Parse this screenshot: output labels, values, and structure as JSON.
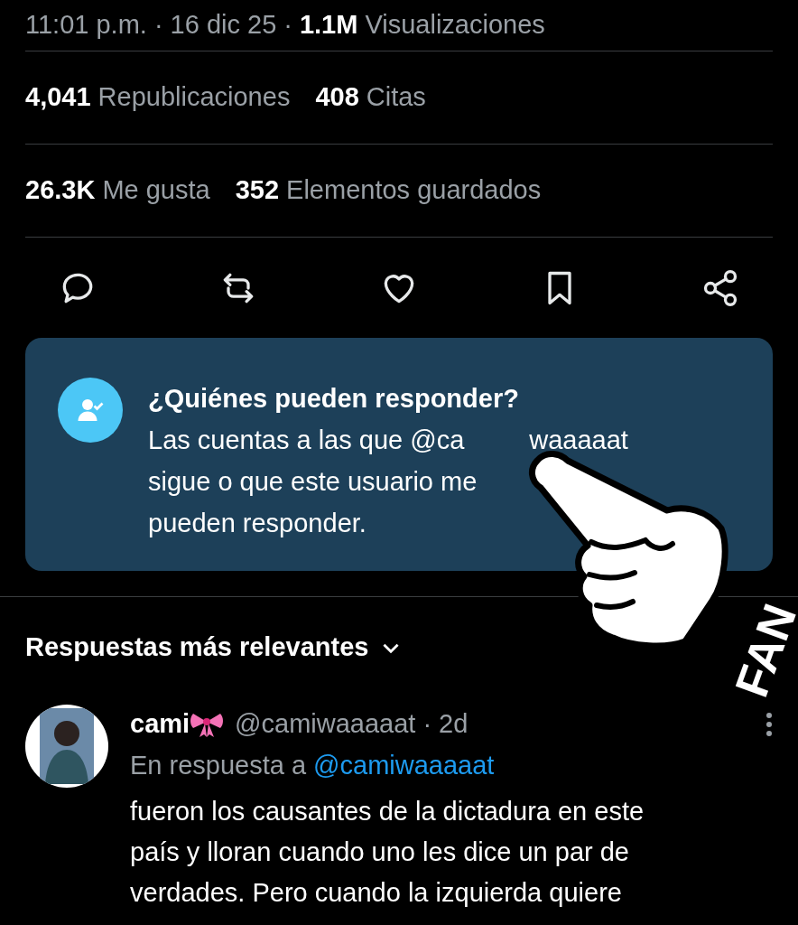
{
  "meta": {
    "time": "11:01 p.m.",
    "sep1": "·",
    "date": "16 dic 25",
    "sep2": "·",
    "views_count": "1.1M",
    "views_label": "Visualizaciones"
  },
  "stats": [
    [
      {
        "count": "4,041",
        "label": "Republicaciones"
      },
      {
        "count": "408",
        "label": "Citas"
      }
    ],
    [
      {
        "count": "26.3K",
        "label": "Me gusta"
      },
      {
        "count": "352",
        "label": "Elementos guardados"
      }
    ]
  ],
  "actions": [
    {
      "kind": "reply"
    },
    {
      "kind": "repost"
    },
    {
      "kind": "like"
    },
    {
      "kind": "bookmark"
    },
    {
      "kind": "share"
    }
  ],
  "notice": {
    "title": "¿Quiénes pueden responder?",
    "line1_start": "Las cuentas a las que @ca",
    "line1_end": "waaaaat",
    "line2": "sigue o que este usuario me",
    "line3": "pueden responder."
  },
  "sticker": {
    "text": "FAN"
  },
  "replies_header": {
    "label": "Respuestas más relevantes",
    "expanded": false
  },
  "reply": {
    "name": "cami",
    "handle": "@camiwaaaaat",
    "sep": "·",
    "age": "2d",
    "in_reply_prefix": "En respuesta a",
    "in_reply_handle": "@camiwaaaaat",
    "lines": [
      "fueron los causantes de la dictadura en este",
      "país y lloran cuando uno les dice un par de",
      "verdades. Pero cuando la izquierda quiere"
    ]
  }
}
